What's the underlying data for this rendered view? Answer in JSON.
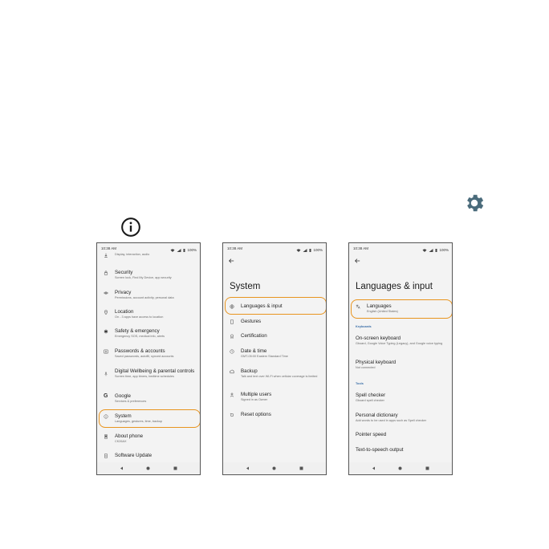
{
  "colors": {
    "accent": "#4a6b7b",
    "highlight": "#e8941e",
    "section": "#3b6fa8"
  },
  "status": {
    "time": "10:38 AM",
    "battery": "100%"
  },
  "phone1": {
    "items": [
      {
        "icon": "display-icon",
        "title": "",
        "sub": "Display, interaction, audio"
      },
      {
        "icon": "lock-icon",
        "title": "Security",
        "sub": "Screen lock, Find My Device, app security"
      },
      {
        "icon": "eye-icon",
        "title": "Privacy",
        "sub": "Permissions, account activity, personal data"
      },
      {
        "icon": "location-icon",
        "title": "Location",
        "sub": "On - 3 apps have access to location"
      },
      {
        "icon": "asterisk-icon",
        "title": "Safety & emergency",
        "sub": "Emergency SOS, medical info, alerts"
      },
      {
        "icon": "account-icon",
        "title": "Passwords & accounts",
        "sub": "Saved passwords, autofill, synced accounts"
      },
      {
        "icon": "wellbeing-icon",
        "title": "Digital Wellbeing & parental controls",
        "sub": "Screen time, app timers, bedtime schedules"
      },
      {
        "icon": "google-icon",
        "title": "Google",
        "sub": "Services & preferences"
      },
      {
        "icon": "info-circle-icon",
        "title": "System",
        "sub": "Languages, gestures, time, backup"
      },
      {
        "icon": "phone-icon",
        "title": "About phone",
        "sub": "CK26AX"
      },
      {
        "icon": "update-icon",
        "title": "Software Update",
        "sub": ""
      }
    ]
  },
  "phone2": {
    "title": "System",
    "items": [
      {
        "icon": "globe-icon",
        "title": "Languages & input",
        "sub": ""
      },
      {
        "icon": "gesture-icon",
        "title": "Gestures",
        "sub": ""
      },
      {
        "icon": "certification-icon",
        "title": "Certification",
        "sub": ""
      },
      {
        "icon": "clock-icon",
        "title": "Date & time",
        "sub": "GMT-05:00 Eastern Standard Time"
      },
      {
        "icon": "backup-icon",
        "title": "Backup",
        "sub": "Talk and text over Wi-Fi when cellular coverage is limited"
      },
      {
        "icon": "users-icon",
        "title": "Multiple users",
        "sub": "Signed in as Owner"
      },
      {
        "icon": "reset-icon",
        "title": "Reset options",
        "sub": ""
      }
    ]
  },
  "phone3": {
    "title": "Languages & input",
    "languages": {
      "title": "Languages",
      "sub": "English (United States)"
    },
    "section_keyboards": "Keyboards",
    "keyboards": [
      {
        "title": "On-screen keyboard",
        "sub": "Gboard, Google Voice Typing (Legacy), and Google voice typing"
      },
      {
        "title": "Physical keyboard",
        "sub": "Not connected"
      }
    ],
    "section_tools": "Tools",
    "tools": [
      {
        "title": "Spell checker",
        "sub": "Gboard spell checker"
      },
      {
        "title": "Personal dictionary",
        "sub": "Add words to be used in apps such as Spell checker"
      },
      {
        "title": "Pointer speed",
        "sub": ""
      },
      {
        "title": "Text-to-speech output",
        "sub": ""
      }
    ]
  }
}
